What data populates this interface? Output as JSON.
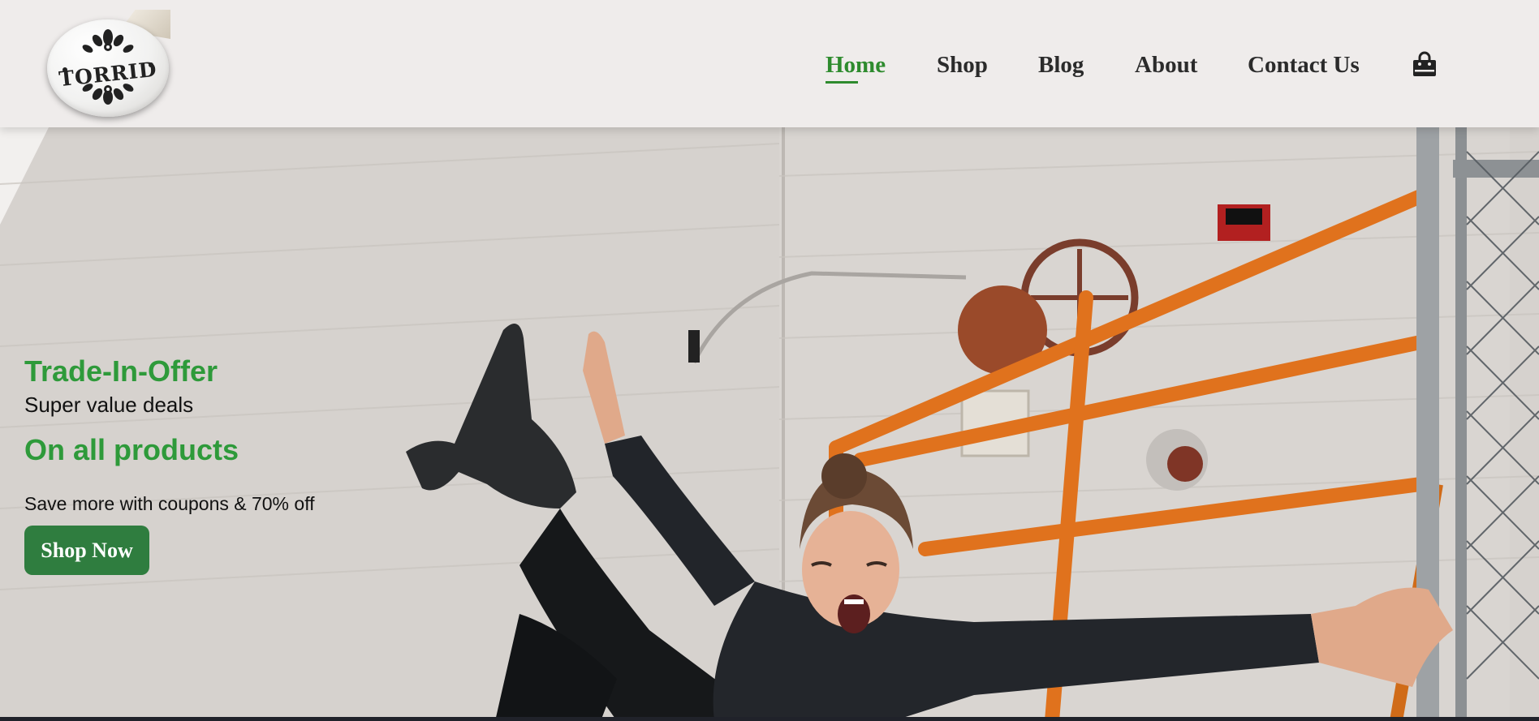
{
  "brand": {
    "logo_text": "TORRID"
  },
  "nav": {
    "items": [
      {
        "label": "Home",
        "active": true
      },
      {
        "label": "Shop",
        "active": false
      },
      {
        "label": "Blog",
        "active": false
      },
      {
        "label": "About",
        "active": false
      },
      {
        "label": "Contact Us",
        "active": false
      }
    ],
    "cart_icon": "shopping-bag-icon"
  },
  "hero": {
    "kicker": "Trade-In-Offer",
    "subtitle": "Super value deals",
    "headline": "On all products",
    "description": "Save more with coupons & 70% off",
    "cta_label": "Shop Now"
  },
  "colors": {
    "accent": "#2e9a3a",
    "button": "#2f7d3f",
    "header_bg": "#efeceb",
    "nav_text": "#2b2b2b"
  }
}
